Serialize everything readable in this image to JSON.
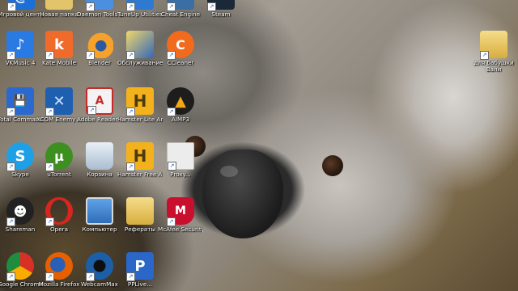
{
  "desktop": {
    "icons": [
      {
        "label": "Игровой центр@Ma...",
        "icon": "game-center-icon",
        "color": "#1b6fd6"
      },
      {
        "label": "Новая папка",
        "icon": "new-folder-icon",
        "color": "#e2c46a"
      },
      {
        "label": "Daemon Tools Lite",
        "icon": "daemon-tools-icon",
        "color": "#4a8fe0"
      },
      {
        "label": "TuneUp Utilities 2013",
        "icon": "tuneup-icon",
        "color": "#2f7ad1"
      },
      {
        "label": "Cheat Engine",
        "icon": "cheat-engine-icon",
        "color": "#3a6ea5"
      },
      {
        "label": "Steam",
        "icon": "steam-icon",
        "color": "#1b2838"
      },
      {
        "label": "VKMusic 4",
        "icon": "vkmusic-icon",
        "color": "#2a7ae4"
      },
      {
        "label": "Kate Mobile",
        "icon": "kate-mobile-icon",
        "color": "#f06a2a"
      },
      {
        "label": "Blender",
        "icon": "blender-icon",
        "color": "#f5a12a"
      },
      {
        "label": "Обслуживание одним щ...",
        "icon": "maintenance-icon",
        "color": "#3467b9"
      },
      {
        "label": "CCleaner",
        "icon": "ccleaner-icon",
        "color": "#f26b1d"
      },
      {
        "label": "Total Commander",
        "icon": "total-commander-icon",
        "color": "#2a6ad0"
      },
      {
        "label": "XCOM Enemy ...",
        "icon": "xcom-icon",
        "color": "#1f5fb0"
      },
      {
        "label": "Adobe Reader 8.0",
        "icon": "adobe-reader-icon",
        "color": "#c62a2a"
      },
      {
        "label": "Hamster Lite Archiver",
        "icon": "hamster-lite-icon",
        "color": "#f3b21c"
      },
      {
        "label": "AIMP3",
        "icon": "aimp-icon",
        "color": "#f2a51a"
      },
      {
        "label": "Skype",
        "icon": "skype-icon",
        "color": "#1ea0e6"
      },
      {
        "label": "uTorrent",
        "icon": "utorrent-icon",
        "color": "#3d8f1f"
      },
      {
        "label": "Корзина",
        "icon": "recycle-bin-icon",
        "color": "#c9d6e3"
      },
      {
        "label": "Hamster Free Archiver",
        "icon": "hamster-free-icon",
        "color": "#f3b21c"
      },
      {
        "label": "Proxy...",
        "icon": "blank-file-icon",
        "color": "#e8e8e8"
      },
      {
        "label": "Shareman",
        "icon": "shareman-icon",
        "color": "#222222"
      },
      {
        "label": "Opera",
        "icon": "opera-icon",
        "color": "#d8261f"
      },
      {
        "label": "Компьютер",
        "icon": "computer-icon",
        "color": "#2f6db8"
      },
      {
        "label": "Рефераты",
        "icon": "documents-folder-icon",
        "color": "#e7c35e"
      },
      {
        "label": "McAfee Security Sc...",
        "icon": "mcafee-icon",
        "color": "#c8102e"
      },
      {
        "label": "Google Chrome",
        "icon": "chrome-icon",
        "color": "#d93025"
      },
      {
        "label": "Mozilla Firefox",
        "icon": "firefox-icon",
        "color": "#e66000"
      },
      {
        "label": "WebcamMax",
        "icon": "webcammax-icon",
        "color": "#1c5fa8"
      },
      {
        "label": "PPLive...",
        "icon": "pplive-icon",
        "color": "#2a67c9"
      },
      {
        "label": "для бабушки Вали",
        "icon": "folder-icon",
        "color": "#e2c46a"
      }
    ]
  }
}
